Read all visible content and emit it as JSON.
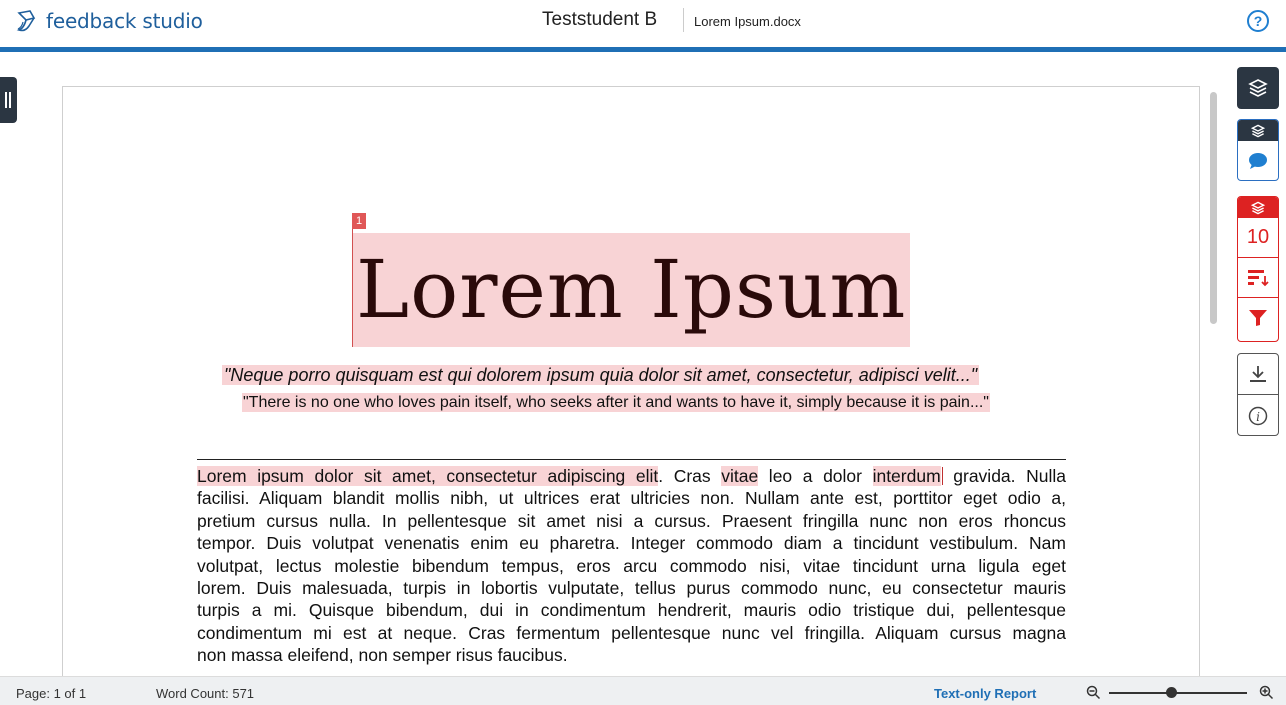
{
  "header": {
    "app_name": "feedback studio",
    "student": "Teststudent B",
    "file_name": "Lorem Ipsum.docx",
    "help_label": "?"
  },
  "document": {
    "match_number": "1",
    "title": "Lorem Ipsum",
    "quote1": "\"Neque porro quisquam est qui dolorem ipsum quia dolor sit amet, consectetur, adipisci velit...\"",
    "quote2": "\"There is no one who loves pain itself, who seeks after it and wants to have it, simply because it is pain...\"",
    "paragraph": {
      "line1": {
        "hl1": "Lorem ipsum dolor sit amet, consectetur adipiscing elit",
        "t1": ". Cras ",
        "hl2": "vitae",
        "t2": " leo a dolor ",
        "hl3": "interdum",
        "t3": " gravida. Nulla"
      },
      "lines": [
        "facilisi. Aliquam blandit mollis nibh, ut ultrices erat ultricies non. Nullam ante est, porttitor eget odio a,",
        "pretium cursus nulla. In pellentesque sit amet nisi a cursus. Praesent fringilla nunc non eros rhoncus",
        "tempor. Duis volutpat venenatis enim eu pharetra. Integer commodo diam a tincidunt vestibulum. Nam",
        "volutpat, lectus molestie bibendum tempus, eros arcu commodo nisi, vitae tincidunt urna ligula eget",
        "lorem. Duis malesuada, turpis in lobortis vulputate, tellus purus commodo nunc, eu consectetur mauris",
        "turpis a mi. Quisque bibendum, dui in condimentum hendrerit, mauris odio tristique dui, pellentesque",
        "condimentum mi est at neque. Cras fermentum pellentesque nunc vel fringilla. Aliquam cursus magna"
      ],
      "last_line": "non massa eleifend, non semper risus faucibus."
    }
  },
  "side_panel": {
    "similarity_count": "10"
  },
  "footer": {
    "page": "Page: 1 of 1",
    "word_count": "Word Count: 571",
    "report_link": "Text-only Report"
  },
  "zoom": {
    "level": 0.45
  },
  "colors": {
    "brand_blue": "#1f6fb5",
    "highlight": "#f8d3d5",
    "similarity_red": "#dd2222",
    "dark": "#2b3642"
  }
}
